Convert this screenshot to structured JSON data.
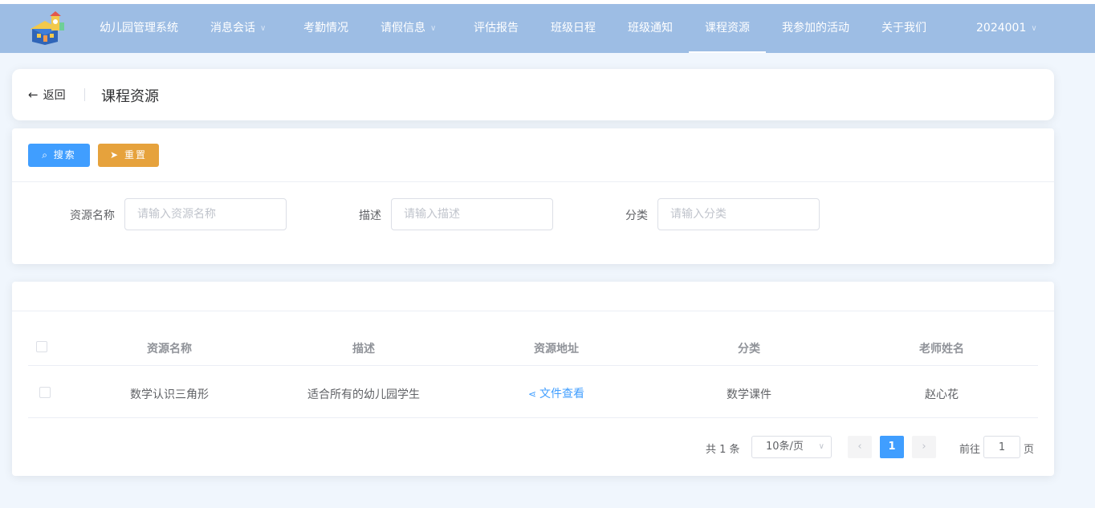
{
  "nav": {
    "logo_icon": "school-building-icon",
    "items": [
      {
        "label": "幼儿园管理系统",
        "dropdown": false
      },
      {
        "label": "消息会话",
        "dropdown": true
      },
      {
        "label": "考勤情况",
        "dropdown": false
      },
      {
        "label": "请假信息",
        "dropdown": true
      },
      {
        "label": "评估报告",
        "dropdown": false
      },
      {
        "label": "班级日程",
        "dropdown": false
      },
      {
        "label": "班级通知",
        "dropdown": false
      },
      {
        "label": "课程资源",
        "dropdown": false,
        "active": true
      },
      {
        "label": "我参加的活动",
        "dropdown": false
      },
      {
        "label": "关于我们",
        "dropdown": false
      },
      {
        "label": "2024001",
        "dropdown": true
      }
    ]
  },
  "header": {
    "back_label": "返回",
    "title": "课程资源"
  },
  "search": {
    "search_button": "搜索",
    "reset_button": "重置",
    "fields": [
      {
        "label": "资源名称",
        "placeholder": "请输入资源名称",
        "value": ""
      },
      {
        "label": "描述",
        "placeholder": "请输入描述",
        "value": ""
      },
      {
        "label": "分类",
        "placeholder": "请输入分类",
        "value": ""
      }
    ]
  },
  "table": {
    "columns": [
      "资源名称",
      "描述",
      "资源地址",
      "分类",
      "老师姓名"
    ],
    "rows": [
      {
        "name": "数学认识三角形",
        "desc": "适合所有的幼儿园学生",
        "address": "文件查看",
        "category": "数学课件",
        "teacher": "赵心花",
        "checked": false
      }
    ]
  },
  "pagination": {
    "total_text": "共 1 条",
    "page_size": "10条/页",
    "prev_icon": "chevron-left-icon",
    "next_icon": "chevron-right-icon",
    "current_page": "1",
    "goto_label": "前往",
    "goto_value": "1",
    "page_label": "页"
  },
  "colors": {
    "nav_bg": "#9dbde4",
    "primary": "#409eff",
    "warning": "#e6a23c",
    "page_bg": "#f0f6fd"
  }
}
